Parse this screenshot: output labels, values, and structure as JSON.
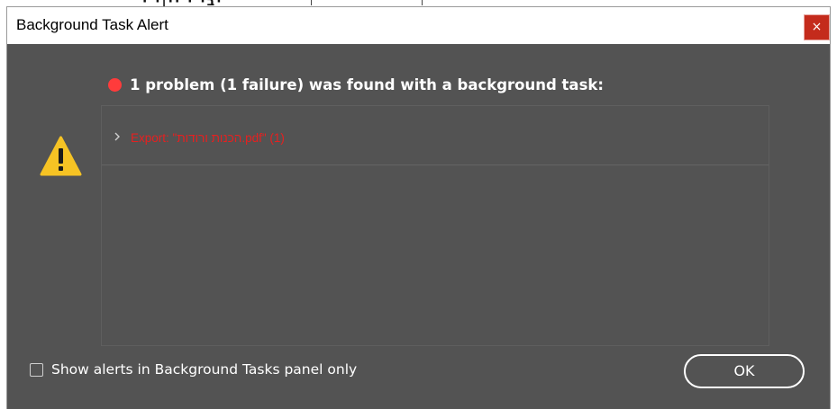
{
  "window": {
    "title": "Background Task Alert",
    "close_glyph": "×"
  },
  "alert": {
    "status_color": "#ff3b3b",
    "headline": "1 problem (1 failure) was found with a background task:",
    "icon": "warning-icon"
  },
  "problems": [
    {
      "text": "Export: \"הכנות ורודות.pdf\" (1)",
      "color": "#e62020",
      "expanded": false
    }
  ],
  "footer": {
    "checkbox_label": "Show alerts in Background Tasks panel only",
    "checkbox_checked": false,
    "ok_label": "OK"
  },
  "colors": {
    "dialog_bg": "#535353",
    "titlebar_bg": "#ffffff",
    "close_bg": "#c42b1c",
    "error_text": "#e62020"
  }
}
